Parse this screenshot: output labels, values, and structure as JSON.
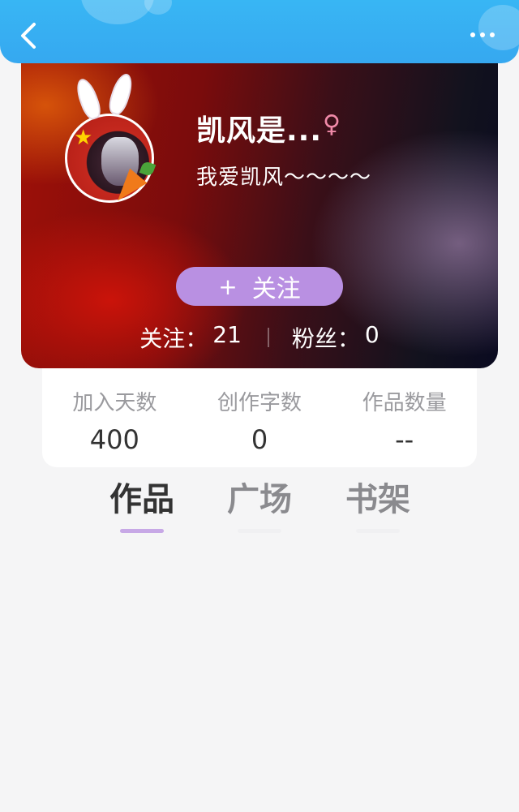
{
  "header": {
    "back_icon": "chevron-left-icon",
    "more_icon": "more-horizontal-icon"
  },
  "profile": {
    "username": "凯风是...",
    "gender_symbol": "♀",
    "bio": "我爱凯风～～～～",
    "follow_plus": "+",
    "follow_label": "关注",
    "following_label": "关注：",
    "following_count": "21",
    "fans_label": "粉丝：",
    "fans_count": "0"
  },
  "stats": [
    {
      "label": "加入天数",
      "value": "400"
    },
    {
      "label": "创作字数",
      "value": "0"
    },
    {
      "label": "作品数量",
      "value": "--"
    }
  ],
  "tabs": [
    {
      "label": "作品",
      "active": true
    },
    {
      "label": "广场",
      "active": false
    },
    {
      "label": "书架",
      "active": false
    }
  ],
  "colors": {
    "header_blue": "#36a8f0",
    "follow_purple": "#b990e2",
    "tab_indicator": "#c7a8e6",
    "gender_pink": "#f08aa8"
  }
}
